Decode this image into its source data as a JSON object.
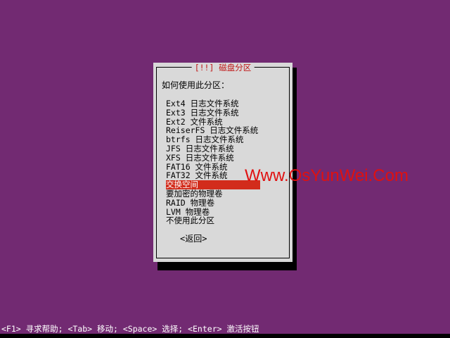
{
  "dialog": {
    "title": "[!!] 磁盘分区",
    "prompt": "如何使用此分区：",
    "options": [
      "Ext4 日志文件系统",
      "Ext3 日志文件系统",
      "Ext2 文件系统",
      "ReiserFS 日志文件系统",
      "btrfs 日志文件系统",
      "JFS 日志文件系统",
      "XFS 日志文件系统",
      "FAT16 文件系统",
      "FAT32 文件系统",
      "交换空间",
      "要加密的物理卷",
      "RAID 物理卷",
      "LVM 物理卷",
      "不使用此分区"
    ],
    "selected_index": 9,
    "back_label": "<返回>"
  },
  "watermark": "Www.OsYunWei.Com",
  "footer": "<F1> 寻求帮助; <Tab> 移动; <Space> 选择; <Enter> 激活按钮",
  "colors": {
    "background": "#722a72",
    "dialog": "#d9d9d9",
    "highlight": "#d22c1c",
    "title": "#c01818"
  }
}
